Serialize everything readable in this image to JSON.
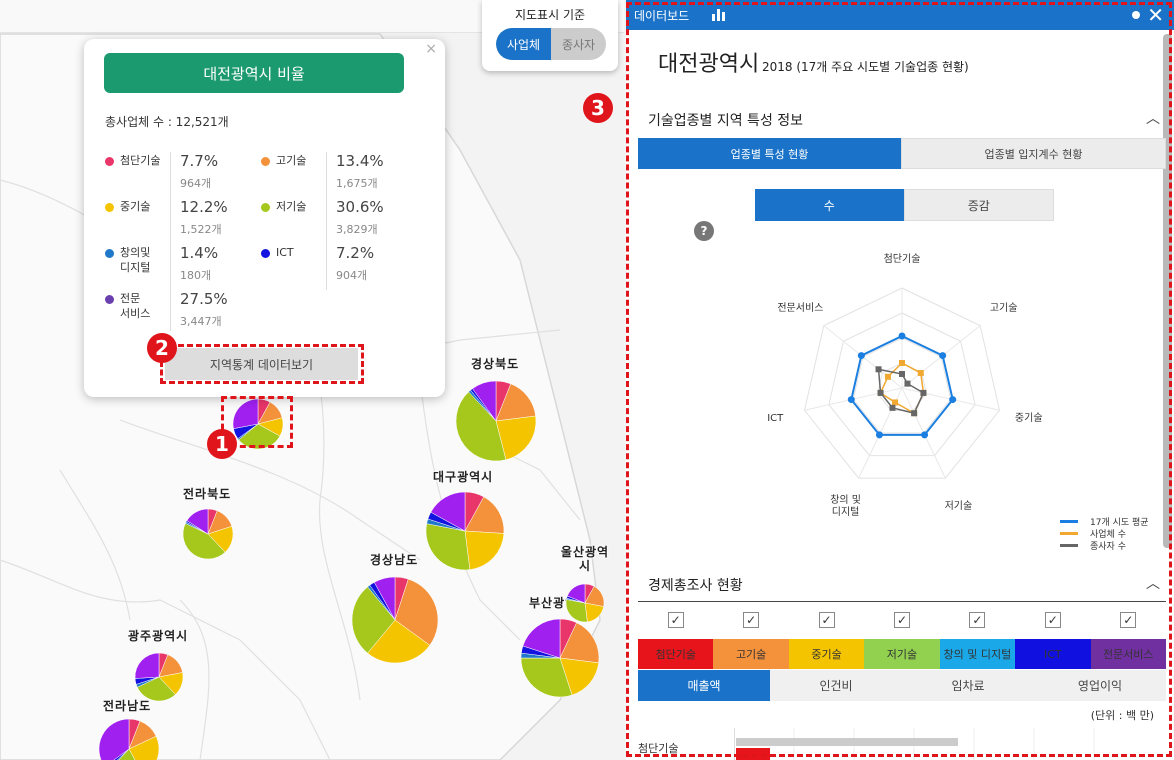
{
  "map": {
    "basis": {
      "title": "지도표시 기준",
      "options": [
        "사업체",
        "종사자"
      ],
      "selected": "사업체"
    },
    "regions": [
      {
        "name": "경상북도",
        "pie": [
          6,
          17,
          23,
          42,
          1,
          1,
          10
        ]
      },
      {
        "name": "대구광역시",
        "pie": [
          8,
          18,
          22,
          30,
          2,
          3,
          17
        ]
      },
      {
        "name": "전라북도",
        "pie": [
          6,
          14,
          18,
          44,
          1,
          1,
          16
        ]
      },
      {
        "name": "경상남도",
        "pie": [
          5,
          30,
          26,
          28,
          1,
          2,
          8
        ]
      },
      {
        "name": "울산광역시",
        "pie": [
          8,
          20,
          20,
          30,
          1,
          2,
          19
        ]
      },
      {
        "name": "부산광역시",
        "pie": [
          7,
          20,
          18,
          30,
          2,
          3,
          20
        ]
      },
      {
        "name": "광주광역시",
        "pie": [
          6,
          16,
          16,
          30,
          2,
          4,
          26
        ]
      },
      {
        "name": "전라남도",
        "pie": [
          6,
          12,
          24,
          20,
          1,
          2,
          35
        ]
      },
      {
        "name": "대전광역시",
        "pie": [
          8,
          13,
          12,
          31,
          1,
          7,
          28
        ]
      }
    ]
  },
  "popup": {
    "title": "대전광역시 비율",
    "total_label": "총사업체 수 : 12,521개",
    "stats": [
      {
        "label": "첨단기술",
        "pct": "7.7%",
        "count": "964개",
        "color": "#e8356a"
      },
      {
        "label": "고기술",
        "pct": "13.4%",
        "count": "1,675개",
        "color": "#f4923c"
      },
      {
        "label": "중기술",
        "pct": "12.2%",
        "count": "1,522개",
        "color": "#f5c400"
      },
      {
        "label": "저기술",
        "pct": "30.6%",
        "count": "3,829개",
        "color": "#a6c81d"
      },
      {
        "label": "창의및\n디지털",
        "pct": "1.4%",
        "count": "180개",
        "color": "#1f78c8"
      },
      {
        "label": "ICT",
        "pct": "7.2%",
        "count": "904개",
        "color": "#1414e0"
      },
      {
        "label": "전문\n서비스",
        "pct": "27.5%",
        "count": "3,447개",
        "color": "#6a3fae"
      }
    ],
    "button_label": "지역통계 데이터보기",
    "close_label": "×"
  },
  "markers": {
    "m1": "1",
    "m2": "2",
    "m3": "3"
  },
  "panel": {
    "header_title": "데이터보드",
    "close_label": "✕",
    "region": "대전광역시",
    "subtitle": "2018 (17개 주요 시도별 기술업종 현황)",
    "section1": {
      "title": "기술업종별 지역 특성 정보",
      "caret": "︿"
    },
    "tabs1": [
      "업종별 특성 현황",
      "업종별 입지계수 현황"
    ],
    "tabs2": [
      "수",
      "증감"
    ],
    "help": "?",
    "section2": {
      "title": "경제총조사 현황",
      "caret": "︿"
    },
    "categories": [
      {
        "label": "첨단기술",
        "color": "#e8141b"
      },
      {
        "label": "고기술",
        "color": "#f4923c"
      },
      {
        "label": "중기술",
        "color": "#f5c400"
      },
      {
        "label": "저기술",
        "color": "#92d050"
      },
      {
        "label": "창의 및 디지털",
        "color": "#1aa8e8"
      },
      {
        "label": "ICT",
        "color": "#1010e0"
      },
      {
        "label": "전문서비스",
        "color": "#7030a0"
      }
    ],
    "check_mark": "✓",
    "tabs3": [
      "매출액",
      "인건비",
      "임차료",
      "영업이익"
    ],
    "unit": "(단위 : 백 만)",
    "bar_row_label": "첨단기술"
  },
  "chart_data": {
    "type": "radar",
    "axes": [
      "첨단기술",
      "고기술",
      "중기술",
      "저기술",
      "창의 및\n디지털",
      "ICT",
      "전문서비스"
    ],
    "rmax": 1.0,
    "series": [
      {
        "name": "17개 시도 평균",
        "color": "#1a7fe0",
        "values": [
          0.52,
          0.52,
          0.52,
          0.52,
          0.52,
          0.52,
          0.52
        ]
      },
      {
        "name": "사업체 수",
        "color": "#f0a830",
        "values": [
          0.25,
          0.24,
          0.22,
          0.28,
          0.16,
          0.22,
          0.18
        ]
      },
      {
        "name": "종사자 수",
        "color": "#666666",
        "values": [
          0.14,
          0.07,
          0.22,
          0.28,
          0.22,
          0.22,
          0.3
        ]
      }
    ]
  }
}
